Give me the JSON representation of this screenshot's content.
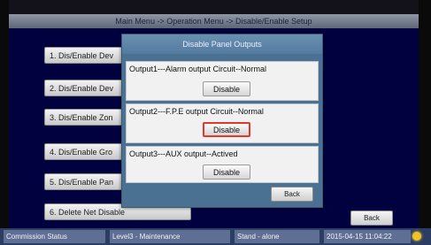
{
  "title_bar": "Main Menu -> Operation Menu -> Disable/Enable Setup",
  "menu_items": [
    "1. Dis/Enable Dev",
    "2. Dis/Enable Dev",
    "3. Dis/Enable Zon",
    "4. Dis/Enable Gro",
    "5. Dis/Enable Pan",
    "6. Delete Net Disable"
  ],
  "back_label": "Back",
  "dialog": {
    "title": "Disable Panel Outputs",
    "outputs": [
      {
        "label": "Output1---Alarm output Circuit--Normal",
        "button": "Disable",
        "highlighted": false
      },
      {
        "label": "Output2---F.P.E output Circuit--Normal",
        "button": "Disable",
        "highlighted": true
      },
      {
        "label": "Output3---AUX output--Actived",
        "button": "Disable",
        "highlighted": false
      }
    ],
    "back_label": "Back"
  },
  "status": {
    "commission": "Commission Status",
    "level": "Level3 - Maintenance",
    "standalone": "Stand - alone",
    "datetime": "2015-04-15 11:04:22"
  },
  "colors": {
    "screen_bg": "#010140",
    "dialog_bg": "#4a7191",
    "status_bar": "#2b3d63",
    "highlight_border": "#e23a2a",
    "status_dot": "#f4c21a"
  }
}
